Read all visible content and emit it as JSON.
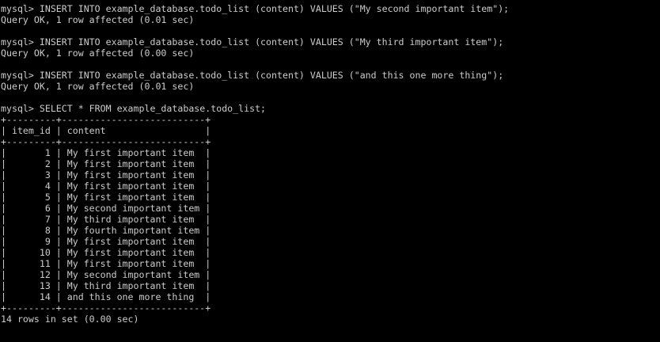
{
  "terminal": {
    "lines": [
      "mysql> INSERT INTO example_database.todo_list (content) VALUES (\"My second important item\");",
      "Query OK, 1 row affected (0.01 sec)",
      "",
      "mysql> INSERT INTO example_database.todo_list (content) VALUES (\"My third important item\");",
      "Query OK, 1 row affected (0.00 sec)",
      "",
      "mysql> INSERT INTO example_database.todo_list (content) VALUES (\"and this one more thing\");",
      "Query OK, 1 row affected (0.01 sec)",
      "",
      "mysql> SELECT * FROM example_database.todo_list;",
      "+---------+--------------------------+",
      "| item_id | content                  |",
      "+---------+--------------------------+",
      "|       1 | My first important item  |",
      "|       2 | My first important item  |",
      "|       3 | My first important item  |",
      "|       4 | My first important item  |",
      "|       5 | My first important item  |",
      "|       6 | My second important item |",
      "|       7 | My third important item  |",
      "|       8 | My fourth important item |",
      "|       9 | My first important item  |",
      "|      10 | My first important item  |",
      "|      11 | My first important item  |",
      "|      12 | My second important item |",
      "|      13 | My third important item  |",
      "|      14 | and this one more thing  |",
      "+---------+--------------------------+",
      "14 rows in set (0.00 sec)"
    ]
  },
  "colors": {
    "background": "#000000",
    "text": "#cccccc"
  }
}
